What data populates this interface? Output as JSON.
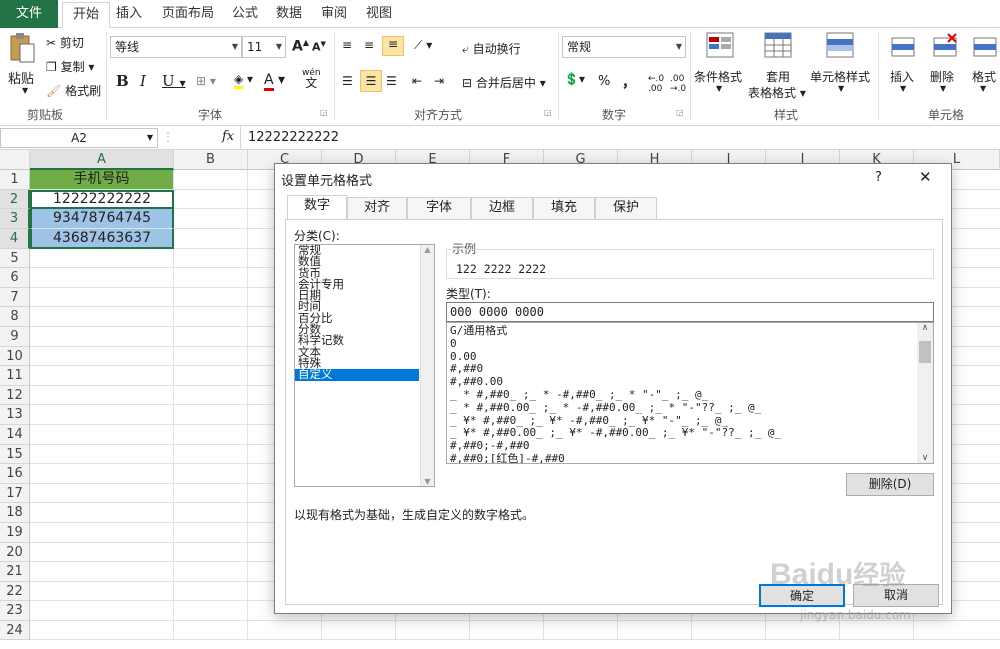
{
  "ribbon_tabs": [
    "文件",
    "开始",
    "插入",
    "页面布局",
    "公式",
    "数据",
    "审阅",
    "视图"
  ],
  "clipboard": {
    "paste": "粘贴",
    "cut": "剪切",
    "copy": "复制",
    "format_painter": "格式刷",
    "label": "剪贴板"
  },
  "font": {
    "name": "等线",
    "size": "11",
    "bold": "B",
    "italic": "I",
    "underline": "U",
    "label": "字体",
    "inc": "A",
    "dec": "A",
    "wen": "wén",
    "wen_char": "文"
  },
  "alignment": {
    "wrap": "自动换行",
    "merge": "合并后居中",
    "label": "对齐方式"
  },
  "number": {
    "format": "常规",
    "percent": "%",
    "comma": "，",
    "label": "数字"
  },
  "styles": {
    "conditional": "条件格式",
    "table": "套用",
    "table2": "表格格式",
    "cell_styles": "单元格样式",
    "label": "样式"
  },
  "cells": {
    "insert": "插入",
    "delete": "删除",
    "format": "格式",
    "label": "单元格"
  },
  "formula_bar": {
    "name_box": "A2",
    "fx": "fx",
    "value": "12222222222"
  },
  "columns": [
    "A",
    "B",
    "C",
    "D",
    "E",
    "F",
    "G",
    "H",
    "I",
    "J",
    "K",
    "L"
  ],
  "rows": [
    "1",
    "2",
    "3",
    "4",
    "5",
    "6",
    "7",
    "8",
    "9",
    "10",
    "11",
    "12",
    "13",
    "14",
    "15",
    "16",
    "17",
    "18",
    "19",
    "20",
    "21",
    "22",
    "23",
    "24"
  ],
  "cells_data": {
    "A1": "手机号码",
    "A2": "12222222222",
    "A3": "93478764745",
    "A4": "43687463637"
  },
  "dialog": {
    "title": "设置单元格格式",
    "help": "?",
    "close": "✕",
    "tabs": [
      "数字",
      "对齐",
      "字体",
      "边框",
      "填充",
      "保护"
    ],
    "category_label": "分类(C):",
    "categories": [
      "常规",
      "数值",
      "货币",
      "会计专用",
      "日期",
      "时间",
      "百分比",
      "分数",
      "科学记数",
      "文本",
      "特殊",
      "自定义"
    ],
    "sample_label": "示例",
    "sample_value": "122 2222 2222",
    "type_label": "类型(T):",
    "type_value": "000 0000 0000",
    "formats": [
      "G/通用格式",
      "0",
      "0.00",
      "#,##0",
      "#,##0.00",
      "_ * #,##0_ ;_ * -#,##0_ ;_ * \"-\"_ ;_ @_",
      "_ * #,##0.00_ ;_ * -#,##0.00_ ;_ * \"-\"??_ ;_ @_",
      "_ ¥* #,##0_ ;_ ¥* -#,##0_ ;_ ¥* \"-\"_ ;_ @_",
      "_ ¥* #,##0.00_ ;_ ¥* -#,##0.00_ ;_ ¥* \"-\"??_ ;_ @_",
      "#,##0;-#,##0",
      "#,##0;[红色]-#,##0"
    ],
    "delete_button": "删除(D)",
    "description": "以现有格式为基础，生成自定义的数字格式。",
    "ok_button": "确定",
    "cancel_button": "取消"
  },
  "colors": {
    "excel_green": "#217346",
    "header_fill": "#70ad47",
    "selection": "#9dc3e6",
    "accent": "#0078d7"
  },
  "watermark": {
    "brand": "Baidu",
    "brand_cn": "经验",
    "url": "jingyan.baidu.com"
  }
}
